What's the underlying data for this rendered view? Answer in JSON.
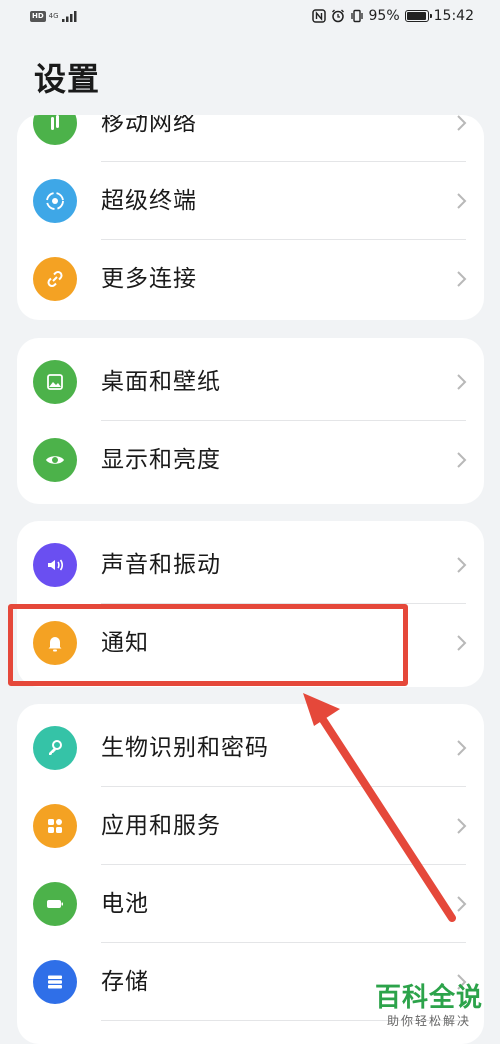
{
  "status_bar": {
    "hd_label": "HD",
    "network_label": "4G",
    "battery_percent": "95%",
    "battery_level": 0.95,
    "time": "15:42"
  },
  "page_title": "设置",
  "groups": [
    {
      "items": [
        {
          "label": "移动网络",
          "icon": "mobile-network-icon",
          "color": "#4cb24a"
        },
        {
          "label": "超级终端",
          "icon": "super-device-icon",
          "color": "#3ea7e7"
        },
        {
          "label": "更多连接",
          "icon": "link-icon",
          "color": "#f4a223"
        }
      ]
    },
    {
      "items": [
        {
          "label": "桌面和壁纸",
          "icon": "wallpaper-icon",
          "color": "#4cb24a"
        },
        {
          "label": "显示和亮度",
          "icon": "eye-icon",
          "color": "#4cb24a"
        }
      ]
    },
    {
      "items": [
        {
          "label": "声音和振动",
          "icon": "speaker-icon",
          "color": "#6a4ff1"
        },
        {
          "label": "通知",
          "icon": "bell-icon",
          "color": "#f4a223"
        }
      ]
    },
    {
      "items": [
        {
          "label": "生物识别和密码",
          "icon": "key-icon",
          "color": "#35c3a7"
        },
        {
          "label": "应用和服务",
          "icon": "apps-icon",
          "color": "#f4a223"
        },
        {
          "label": "电池",
          "icon": "battery-icon",
          "color": "#4cb24a"
        },
        {
          "label": "存储",
          "icon": "storage-icon",
          "color": "#2f6fe8"
        }
      ]
    }
  ],
  "watermark": {
    "title": "百科全说",
    "subtitle": "助你轻松解决"
  }
}
